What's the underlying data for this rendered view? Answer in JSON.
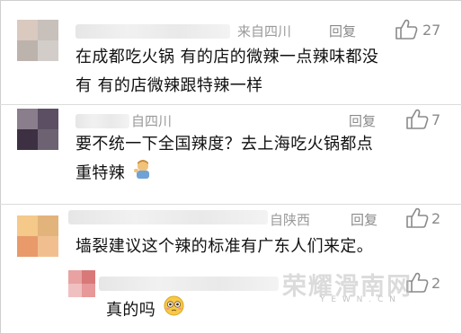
{
  "comments": [
    {
      "origin": "来自四川",
      "reply_label": "回复",
      "likes": "27",
      "text_line1": "在成都吃火锅 有的店的微辣一点辣味都没",
      "text_line2": "有 有的店微辣跟特辣一样"
    },
    {
      "origin": "自四川",
      "reply_label": "回复",
      "likes": "7",
      "text_line1": "要不统一下全国辣度？去上海吃火锅都点",
      "text_line2": "重特辣"
    },
    {
      "origin": "自陕西",
      "reply_label": "回复",
      "likes": "2",
      "text_line1": "墙裂建议这个辣的标准有广东人们来定。"
    }
  ],
  "subreply": {
    "likes": "2",
    "text": "真的吗"
  },
  "watermark": {
    "text": "荣耀滑南网",
    "sub": "Y E W N . C N"
  },
  "colors": {
    "meta_gray": "#8a8a8a",
    "separator": "#dcdcdc"
  }
}
